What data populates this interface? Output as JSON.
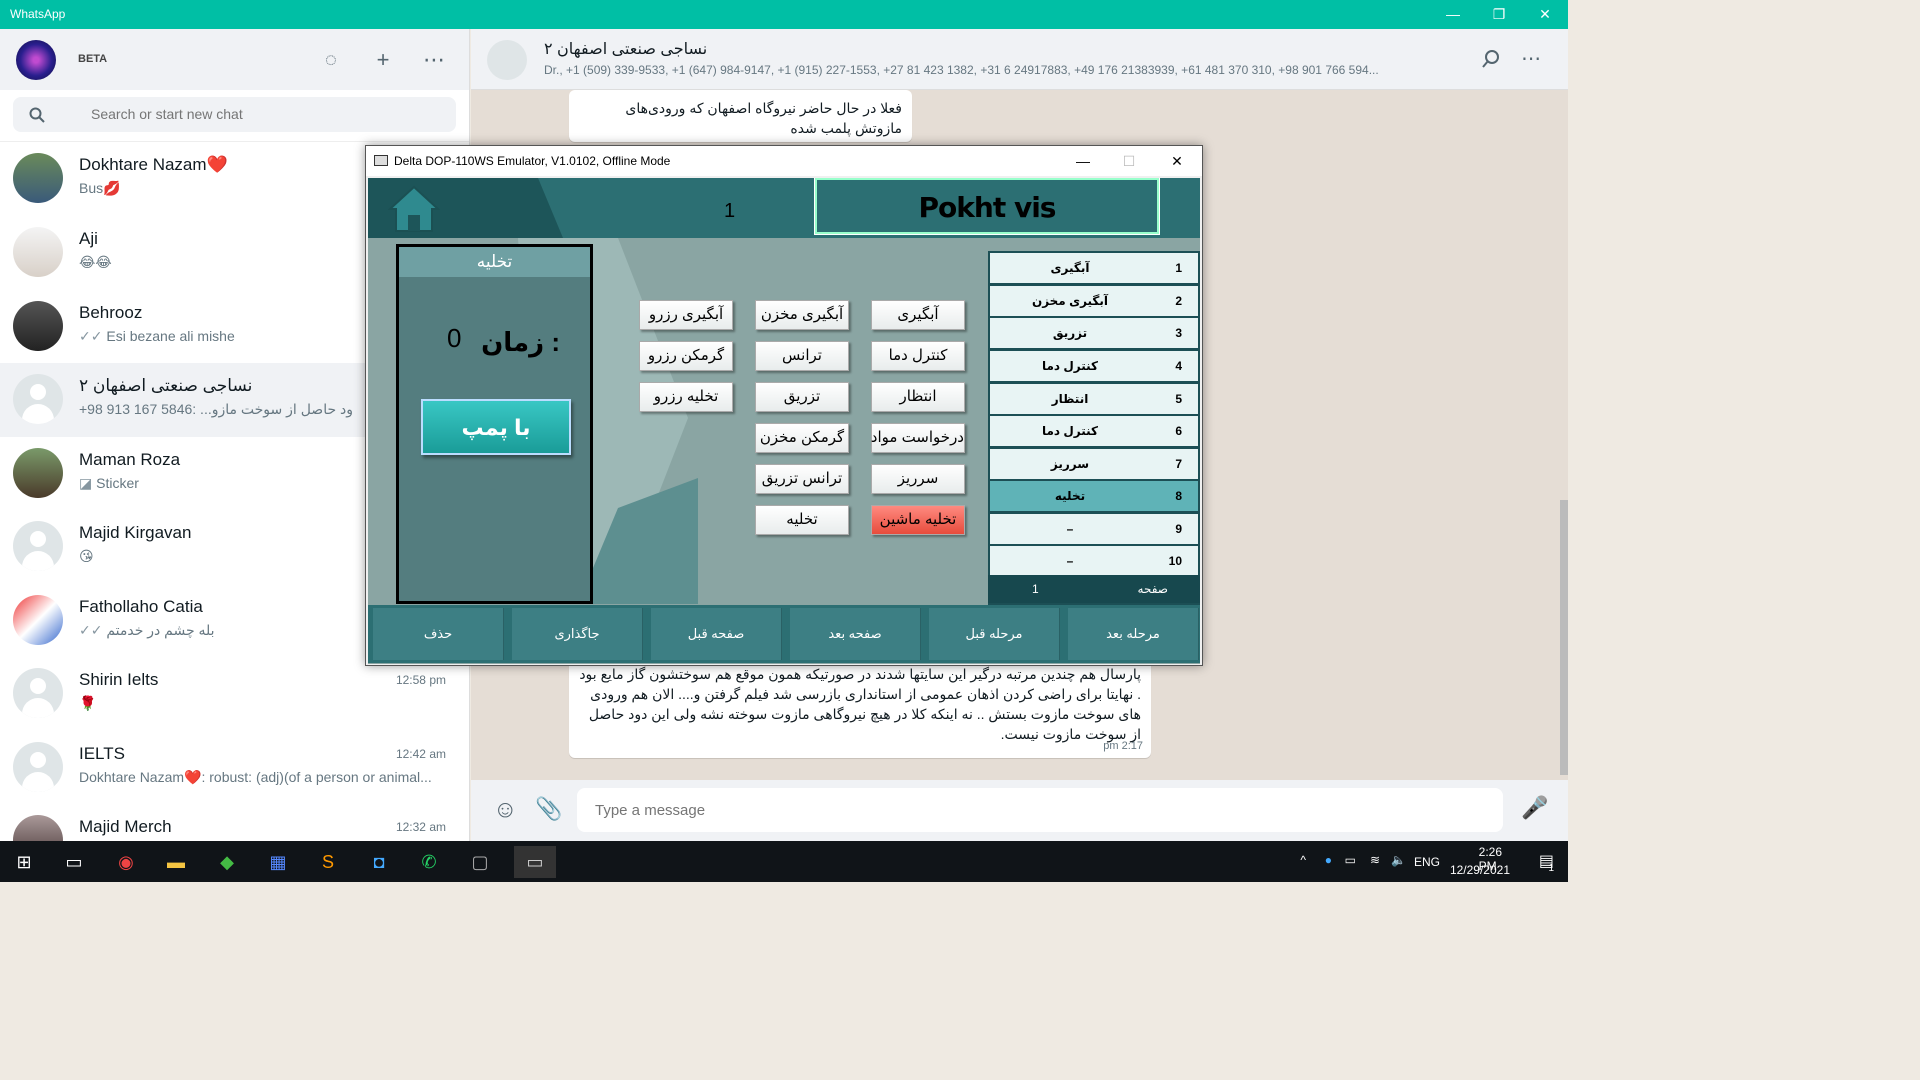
{
  "app_title": "WhatsApp",
  "sidebar": {
    "beta_label": "BETA",
    "search_placeholder": "Search or start new chat",
    "chats": [
      {
        "name": "Dokhtare Nazam❤️",
        "message": "Bus💋",
        "time": ""
      },
      {
        "name": "Aji",
        "message": "😂😂",
        "time": ""
      },
      {
        "name": "Behrooz",
        "message": "Esi bezane ali mishe",
        "time": ""
      },
      {
        "name": "نساجی صنعتی اصفهان ۲",
        "message": "+98 913 167 5846: ...ود حاصل از سوخت مازو",
        "time": ""
      },
      {
        "name": "Maman Roza",
        "message": "Sticker",
        "time": ""
      },
      {
        "name": "Majid Kirgavan",
        "message": "😘",
        "time": ""
      },
      {
        "name": "Fathollaho Catia",
        "message": "بله چشم در خدمتم",
        "time": ""
      },
      {
        "name": "Shirin Ielts",
        "message": "🌹",
        "time": "12:58 pm"
      },
      {
        "name": "IELTS",
        "message": "Dokhtare Nazam❤️: robust: (adj)(of a person or animal...",
        "time": "12:42 am"
      },
      {
        "name": "Majid Merch",
        "message": "",
        "time": "12:32 am"
      }
    ]
  },
  "conversation": {
    "title": "نساجی صنعتی اصفهان ۲",
    "members": "Dr., +1 (509) 339-9533, +1 (647) 984-9147, +1 (915) 227-1553, +27 81 423 1382, +31 6 24917883, +49 176 21383939, +61 481 370 310, +98 901 766 594...",
    "top_message": "فعلا در حال حاضر نیروگاه اصفهان که ورودی‌های مازوتش پلمب شده",
    "bottom_message": "پارسال هم چندین مرتبه درگیر این سایتها شدند در صورتیکه همون موقع هم سوختشون گاز مایع بود . نهایتا برای راضی کردن اذهان عمومی از استانداری بازرسی شد فیلم گرفتن و.... الان هم ورودی های سوخت مازوت بستش .. نه اینکه کلا در هیچ نیروگاهی مازوت سوخته نشه ولی این دود حاصل از سوخت مازوت نیست.",
    "bottom_time": "2:17 pm",
    "composer_placeholder": "Type a message"
  },
  "emulator": {
    "window_title": "Delta DOP-110WS Emulator, V1.0102, Offline Mode",
    "page_number": "1",
    "program_name": "Pokht vis",
    "panel_title": "تخلیه",
    "time_label": "زمان :",
    "time_value": "0",
    "pump_label": "با پمپ",
    "buttons": [
      "آبگیری رزرو",
      "آبگیری مخزن",
      "آبگیری",
      "گرمکن رزرو",
      "ترانس",
      "کنترل دما",
      "تخلیه رزرو",
      "تزریق",
      "انتظار",
      "گرمکن مخزن",
      "درخواست مواد",
      "ترانس تزریق",
      "سرریز",
      "تخلیه",
      "تخلیه ماشین"
    ],
    "steps": [
      {
        "n": "1",
        "label": "آبگیری"
      },
      {
        "n": "2",
        "label": "آبگیری مخزن"
      },
      {
        "n": "3",
        "label": "تزریق"
      },
      {
        "n": "4",
        "label": "کنترل دما"
      },
      {
        "n": "5",
        "label": "انتظار"
      },
      {
        "n": "6",
        "label": "کنترل دما"
      },
      {
        "n": "7",
        "label": "سرریز"
      },
      {
        "n": "8",
        "label": "تخلیه"
      },
      {
        "n": "9",
        "label": "–"
      },
      {
        "n": "10",
        "label": "–"
      }
    ],
    "active_step": "8",
    "page_footer_label": "صفحه",
    "page_footer_value": "1",
    "bottom_buttons": [
      "حذف",
      "جاگذاری",
      "صفحه قبل",
      "صفحه بعد",
      "مرحله قبل",
      "مرحله بعد"
    ]
  },
  "taskbar": {
    "language": "ENG",
    "time": "2:26 PM",
    "date": "12/29/2021",
    "notifications": "1"
  },
  "colors": {
    "whatsapp_green": "#00bfa5",
    "hmi_teal": "#2c6f73",
    "hmi_alarm_red": "#e74c3c"
  }
}
